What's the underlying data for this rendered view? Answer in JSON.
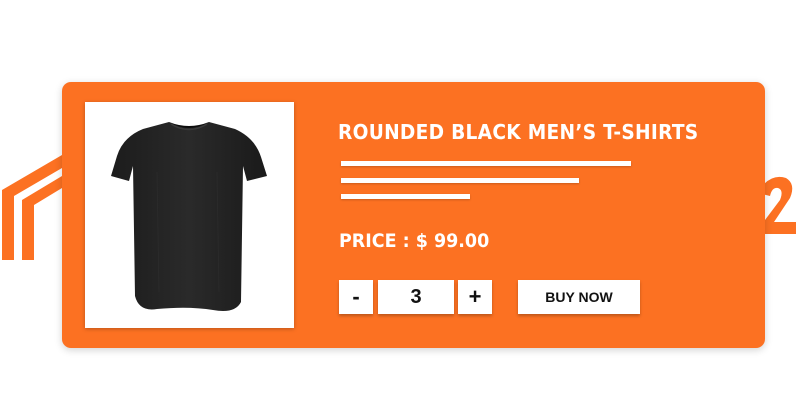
{
  "colors": {
    "card_background": "#FC7122",
    "background_logo": "#FC7122",
    "text": "#FFFFFF",
    "button_background": "#FFFFFF",
    "button_text": "#111111"
  },
  "product": {
    "title": "ROUNDED BLACK MEN’S T-SHIRTS",
    "price_label": "PRICE : $ 99.00",
    "image_icon": "black-t-shirt"
  },
  "quantity": {
    "decrement_label": "-",
    "value": "3",
    "increment_label": "+"
  },
  "actions": {
    "buy_label": "BUY NOW"
  }
}
